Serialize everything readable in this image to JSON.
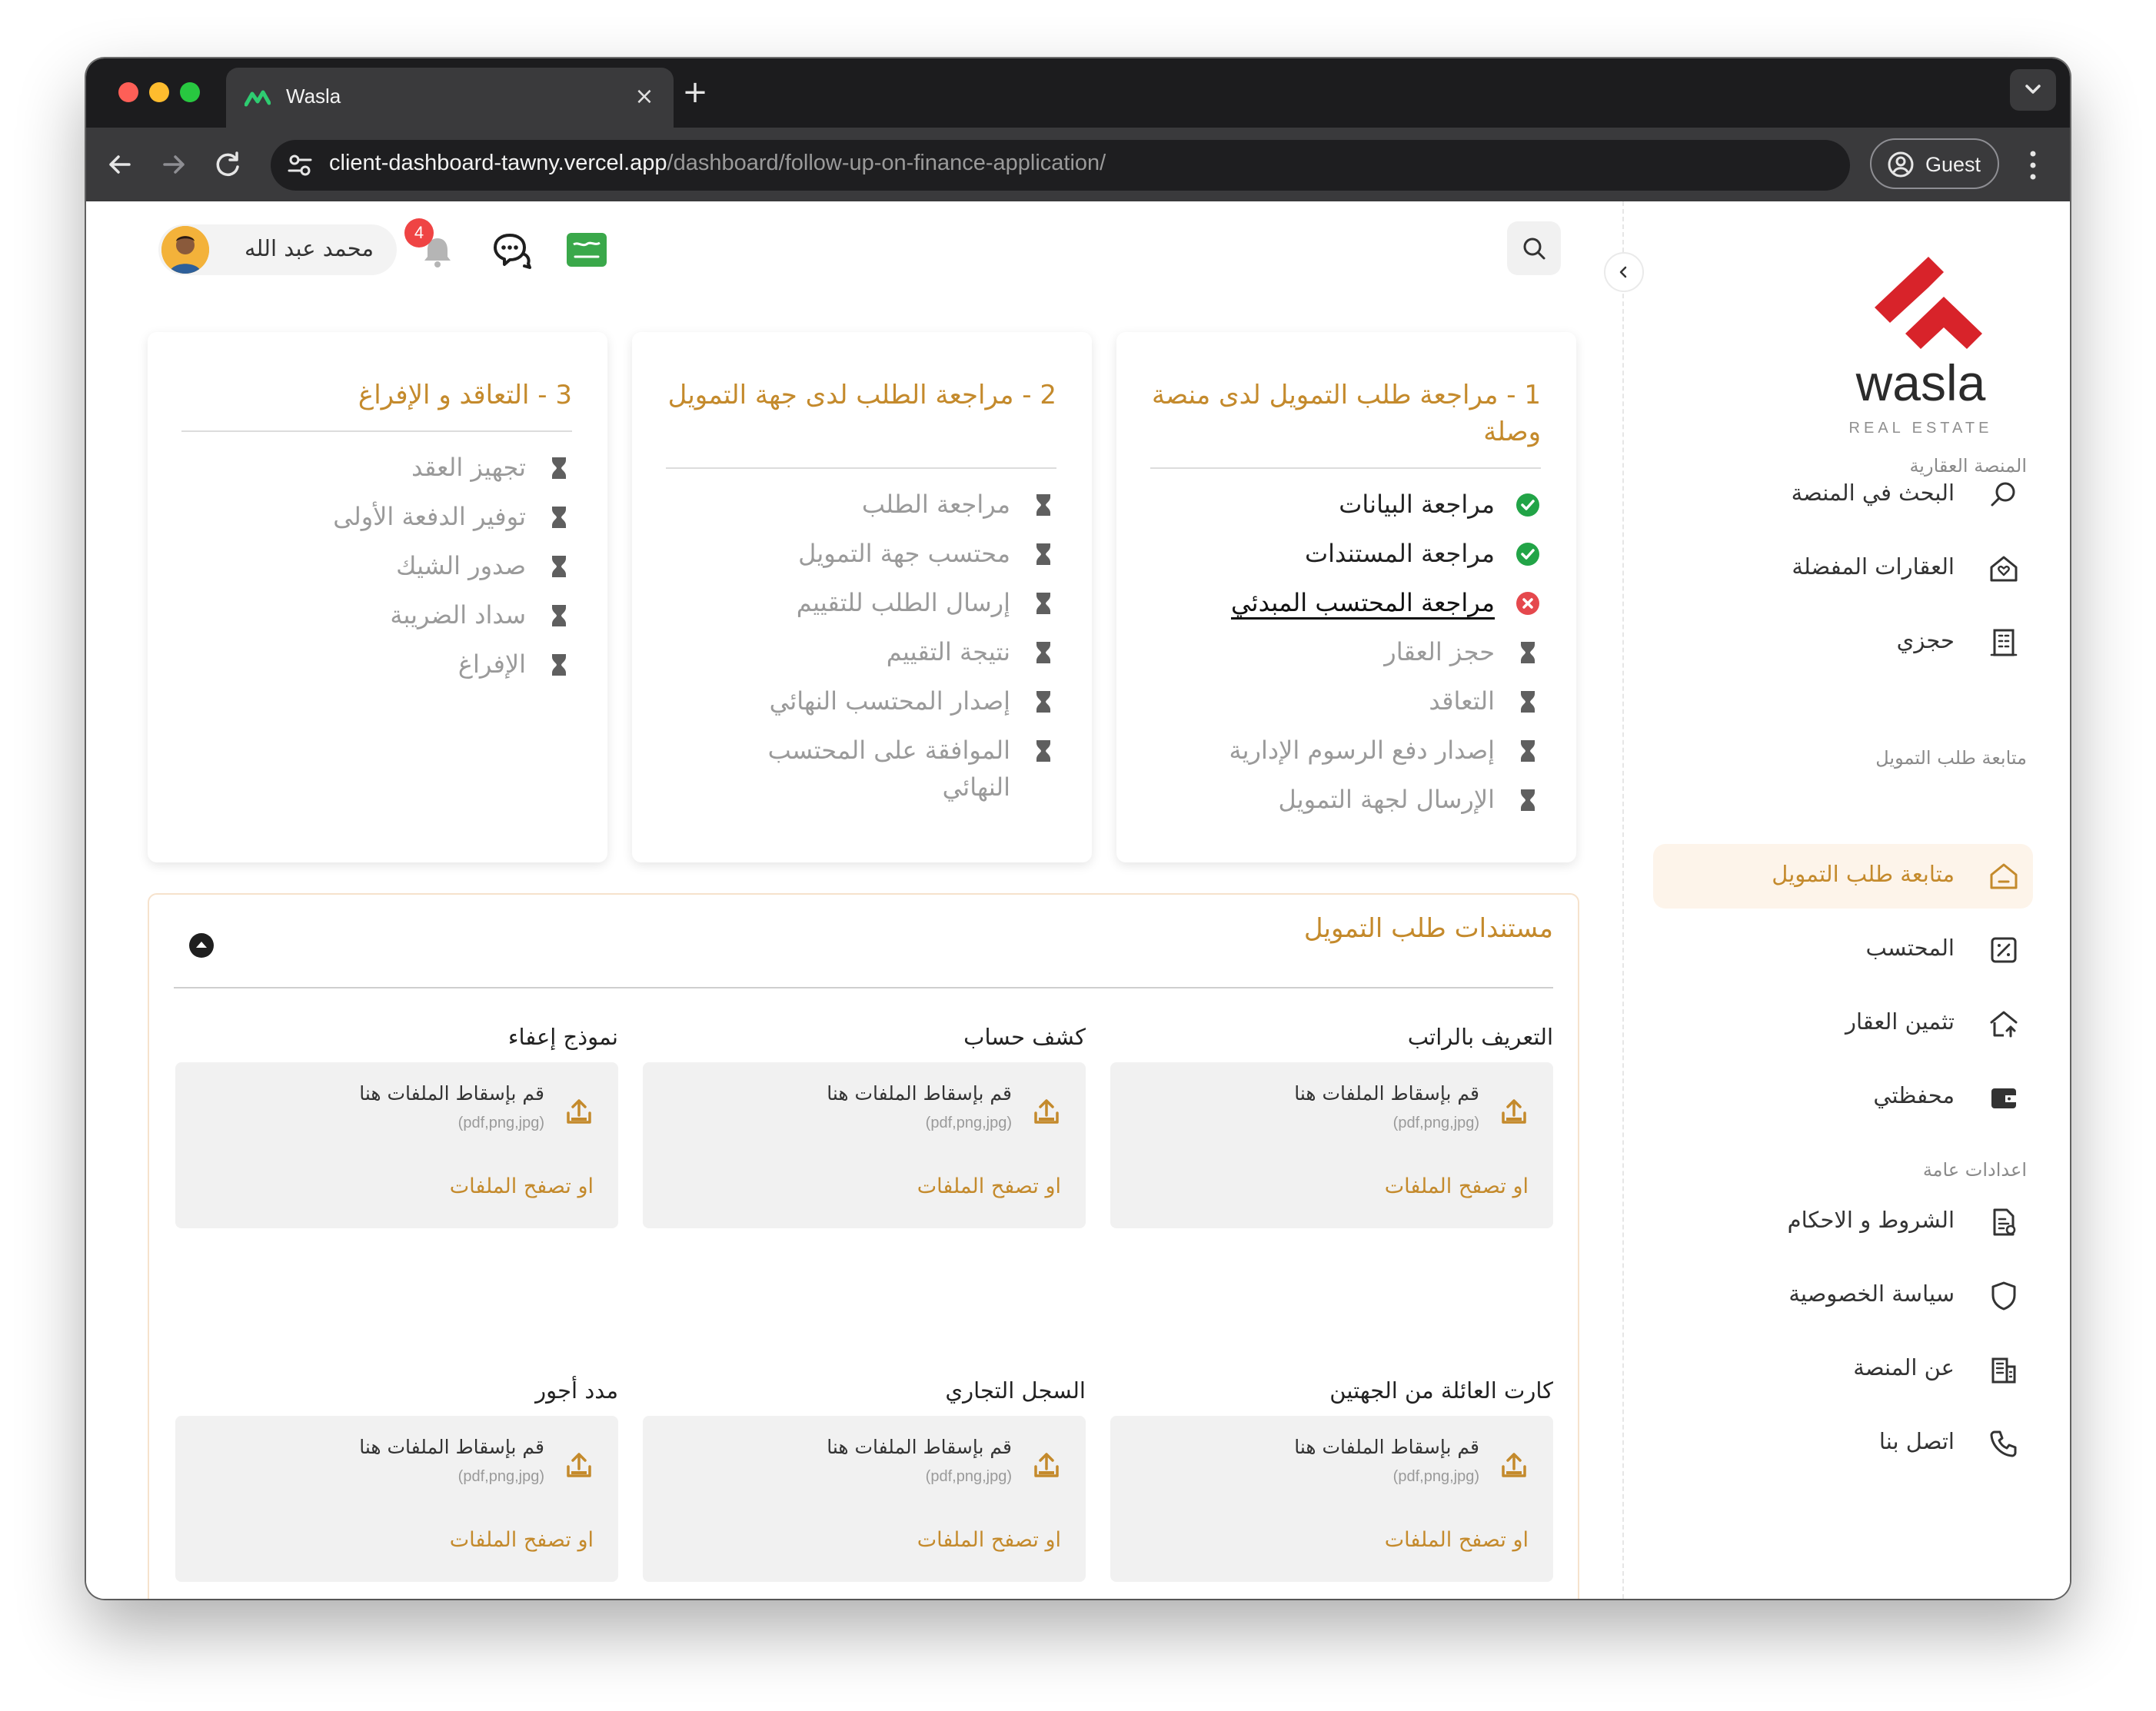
{
  "browser": {
    "tab_title": "Wasla",
    "url_host": "client-dashboard-tawny.vercel.app",
    "url_path": "/dashboard/follow-up-on-finance-application/",
    "profile_label": "Guest"
  },
  "header": {
    "user_name": "محمد عبد الله",
    "notification_count": "4"
  },
  "sidebar": {
    "brand": "wasla",
    "brand_sub": "REAL ESTATE",
    "sections": [
      {
        "title": "المنصة العقارية"
      },
      {
        "title": "متابعة طلب التمويل"
      },
      {
        "title": "اعدادات عامة"
      }
    ],
    "items": [
      {
        "label": "البحث في المنصة",
        "icon": "search-icon"
      },
      {
        "label": "العقارات المفضلة",
        "icon": "favorite-home-icon"
      },
      {
        "label": "حجزي",
        "icon": "building-icon"
      },
      {
        "label": "متابعة طلب التمويل",
        "icon": "home-icon",
        "active": true
      },
      {
        "label": "المحتسب",
        "icon": "percent-icon"
      },
      {
        "label": "تثمين العقار",
        "icon": "home-upload-icon"
      },
      {
        "label": "محفظتي",
        "icon": "wallet-icon"
      },
      {
        "label": "الشروط و الاحكام",
        "icon": "document-icon"
      },
      {
        "label": "سياسة الخصوصية",
        "icon": "shield-icon"
      },
      {
        "label": "عن المنصة",
        "icon": "office-icon"
      },
      {
        "label": "اتصل بنا",
        "icon": "phone-icon"
      }
    ]
  },
  "steps": [
    {
      "title": "1 - مراجعة طلب التمويل لدى منصة وصلة",
      "items": [
        {
          "label": "مراجعة البيانات",
          "status": "done"
        },
        {
          "label": "مراجعة المستندات",
          "status": "done"
        },
        {
          "label": "مراجعة المحتسب المبدئي",
          "status": "rejected"
        },
        {
          "label": "حجز العقار",
          "status": "pending"
        },
        {
          "label": "التعاقد",
          "status": "pending"
        },
        {
          "label": "إصدار دفع الرسوم الإدارية",
          "status": "pending"
        },
        {
          "label": "الإرسال لجهة التمويل",
          "status": "pending"
        }
      ]
    },
    {
      "title": "2 - مراجعة الطلب لدى جهة التمويل",
      "items": [
        {
          "label": "مراجعة الطلب",
          "status": "pending"
        },
        {
          "label": "محتسب جهة التمويل",
          "status": "pending"
        },
        {
          "label": "إرسال الطلب للتقييم",
          "status": "pending"
        },
        {
          "label": "نتيجة التقييم",
          "status": "pending"
        },
        {
          "label": "إصدار المحتسب النهائي",
          "status": "pending"
        },
        {
          "label": "الموافقة على المحتسب النهائي",
          "status": "pending"
        }
      ]
    },
    {
      "title": "3 - التعاقد و الإفراغ",
      "items": [
        {
          "label": "تجهيز العقد",
          "status": "pending"
        },
        {
          "label": "توفير الدفعة الأولى",
          "status": "pending"
        },
        {
          "label": "صدور الشيك",
          "status": "pending"
        },
        {
          "label": "سداد الضريبة",
          "status": "pending"
        },
        {
          "label": "الإفراغ",
          "status": "pending"
        }
      ]
    }
  ],
  "documents": {
    "title": "مستندات طلب التمويل",
    "drop_text": "قم بإسقاط الملفات هنا",
    "file_types": "(pdf,png,jpg)",
    "browse_text": "او تصفح الملفات",
    "items": [
      {
        "label": "التعريف بالراتب"
      },
      {
        "label": "كشف حساب"
      },
      {
        "label": "نموذج إعفاء"
      },
      {
        "label": "كارت العائلة من الجهتين"
      },
      {
        "label": "السجل التجاري"
      },
      {
        "label": "مدد أجور"
      }
    ]
  },
  "colors": {
    "accent": "#c48a2c",
    "brand_red": "#d8232a",
    "success": "#22a447",
    "error": "#e5484d",
    "active_bg": "#fdf4ea"
  }
}
